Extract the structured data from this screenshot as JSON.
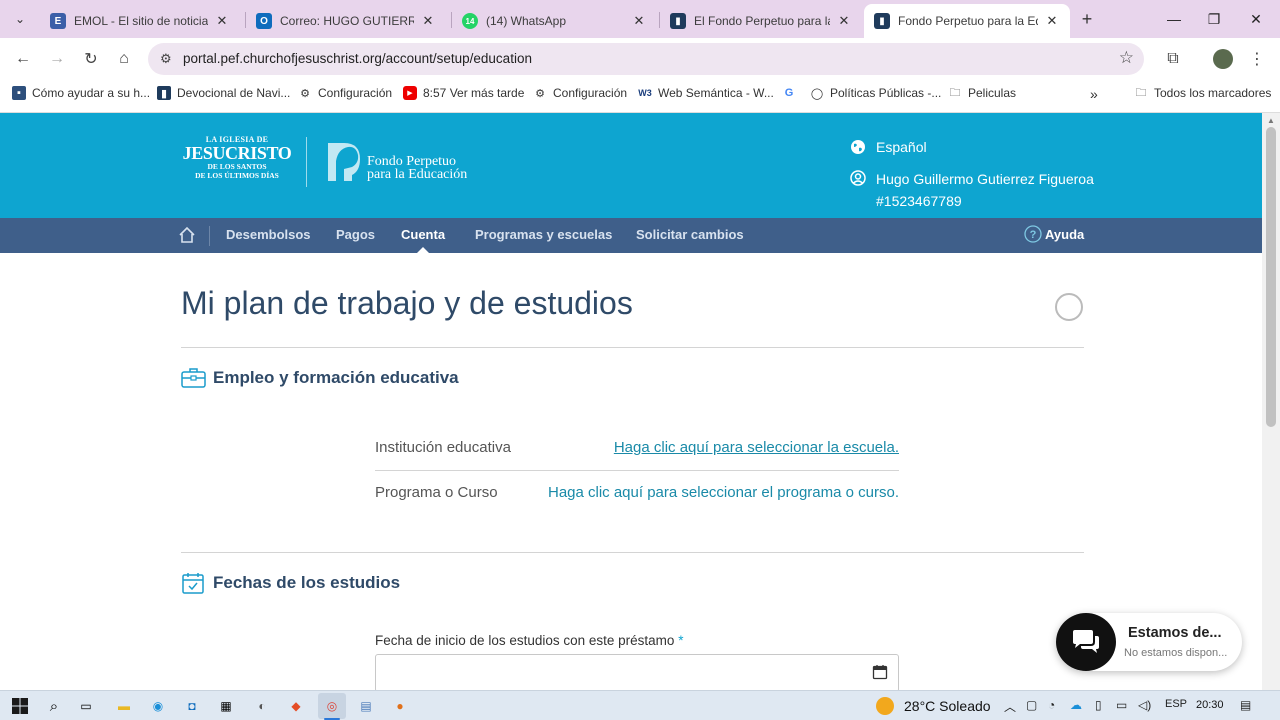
{
  "browser": {
    "tabs": [
      {
        "title": "EMOL - El sitio de noticias o",
        "icon": "emol-icon",
        "color": "#3b5fa8"
      },
      {
        "title": "Correo: HUGO GUTIERREZ F",
        "icon": "outlook-icon",
        "color": "#0f6cbd"
      },
      {
        "title": "(14) WhatsApp",
        "icon": "whatsapp-icon",
        "color": "#25d366",
        "badge": "14"
      },
      {
        "title": "El Fondo Perpetuo para la E",
        "icon": "pef-icon",
        "color": "#1f3b5c"
      },
      {
        "title": "Fondo Perpetuo para la Edu",
        "icon": "pef-icon",
        "color": "#1f3b5c"
      }
    ],
    "url": "portal.pef.churchofjesuschrist.org/account/setup/education",
    "bookmarks": [
      {
        "label": "Cómo ayudar a su h...",
        "icon": "bookmark-site-icon"
      },
      {
        "label": "Devocional de Navi...",
        "icon": "bookmark-site-icon"
      },
      {
        "label": "Configuración",
        "icon": "gear-icon"
      },
      {
        "label": "8:57 Ver más tarde",
        "icon": "youtube-icon"
      },
      {
        "label": "Configuración",
        "icon": "gear-icon"
      },
      {
        "label": "Web Semántica - W...",
        "icon": "w3-icon"
      },
      {
        "label": "",
        "icon": "google-icon"
      },
      {
        "label": "Políticas Públicas -...",
        "icon": "globe-icon"
      },
      {
        "label": "Peliculas",
        "icon": "folder-icon"
      }
    ],
    "bookmarks_overflow": "»",
    "all_bookmarks": "Todos los marcadores"
  },
  "header": {
    "church_logo": {
      "line1": "LA IGLESIA DE",
      "line2": "JESUCRISTO",
      "line3": "DE LOS SANTOS",
      "line4": "DE LOS ÚLTIMOS DÍAS"
    },
    "pef_logo": {
      "line1": "Fondo Perpetuo",
      "line2": "para la Educación"
    },
    "language": "Español",
    "user_name": "Hugo Guillermo Gutierrez Figueroa",
    "user_id": "#1523467789"
  },
  "nav": {
    "items": [
      "Desembolsos",
      "Pagos",
      "Cuenta",
      "Programas y escuelas",
      "Solicitar cambios"
    ],
    "active": "Cuenta",
    "help": "Ayuda"
  },
  "main": {
    "title": "Mi plan de trabajo y de estudios",
    "section1": {
      "heading": "Empleo y formación educativa",
      "fields": [
        {
          "label": "Institución educativa",
          "value": "Haga clic aquí para seleccionar la escuela."
        },
        {
          "label": "Programa o Curso",
          "value": "Haga clic aquí para seleccionar el programa o curso."
        }
      ]
    },
    "section2": {
      "heading": "Fechas de los estudios",
      "start_date_label": "Fecha de inicio de los estudios con este préstamo",
      "required_mark": "*",
      "start_date_value": ""
    }
  },
  "chat": {
    "title": "Estamos de...",
    "subtitle": "No estamos dispon..."
  },
  "taskbar": {
    "weather": "28°C Soleado",
    "language": "ESP",
    "time": "20:30"
  },
  "colors": {
    "header_bg": "#0ea5d0",
    "nav_bg": "#3f5f8a",
    "title": "#2f4a68",
    "link": "#1a8aa8"
  }
}
